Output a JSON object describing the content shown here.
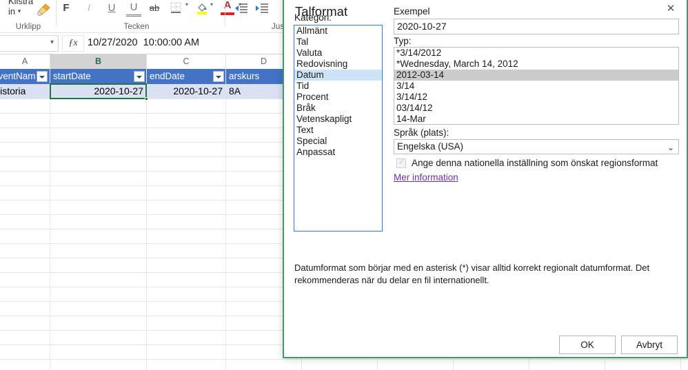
{
  "app": {
    "ribbon": {
      "groups": [
        {
          "label": "Urklipp"
        },
        {
          "label": "Tecken"
        },
        {
          "label": "Juster"
        }
      ],
      "paste_label_line1": "Klistra",
      "paste_label_line2": "in",
      "font_buttons": [
        {
          "name": "bold",
          "glyph": "F"
        },
        {
          "name": "italic",
          "glyph": "I"
        },
        {
          "name": "underline",
          "glyph": "U"
        },
        {
          "name": "double-underline",
          "glyph": "U"
        },
        {
          "name": "strikethrough",
          "glyph": "ab"
        },
        {
          "name": "borders",
          "glyph": "⊞"
        },
        {
          "name": "fill-color",
          "glyph": "◇"
        },
        {
          "name": "font-color",
          "glyph": "A"
        }
      ]
    },
    "formula_bar": {
      "name_box_value": "",
      "fx_label": "ƒx",
      "formula_value": "10/27/2020  10:00:00 AM"
    },
    "sheet": {
      "column_headers": [
        "A",
        "B",
        "C",
        "D"
      ],
      "selected_column": "B",
      "table_headers": [
        "eventNam",
        "startDate",
        "endDate",
        "arskurs"
      ],
      "rows": [
        [
          "Historia",
          "2020-10-27",
          "2020-10-27",
          "8A"
        ]
      ]
    }
  },
  "dialog": {
    "title": "Talformat",
    "close_icon": "✕",
    "category_label": "Kategori:",
    "categories": [
      "Allmänt",
      "Tal",
      "Valuta",
      "Redovisning",
      "Datum",
      "Tid",
      "Procent",
      "Bråk",
      "Vetenskapligt",
      "Text",
      "Special",
      "Anpassat"
    ],
    "selected_category": "Datum",
    "example_label": "Exempel",
    "example_value": "2020-10-27",
    "type_label": "Typ:",
    "types": [
      "*3/14/2012",
      "*Wednesday, March 14, 2012",
      "2012-03-14",
      "3/14",
      "3/14/12",
      "03/14/12",
      "14-Mar"
    ],
    "selected_type": "2012-03-14",
    "locale_label": "Språk (plats):",
    "locale_value": "Engelska (USA)",
    "locale_caret": "⌄",
    "checkbox_label": "Ange denna nationella inställning som önskat regionsformat",
    "checkbox_checked": true,
    "checkbox_tick": "✓",
    "more_info_link": "Mer information",
    "description": "Datumformat som börjar med en asterisk (*) visar alltid korrekt regionalt datumformat. Det rekommenderas när du delar en fil internationellt.",
    "ok_label": "OK",
    "cancel_label": "Avbryt"
  },
  "colors": {
    "dialog_border": "#3c9a6b",
    "table_header_bg": "#4472C4",
    "table_row_bg": "#D9E1F2",
    "category_selection": "#cce4f7",
    "type_selection": "#cccccc",
    "link": "#7030a0",
    "excel_green": "#217346"
  }
}
